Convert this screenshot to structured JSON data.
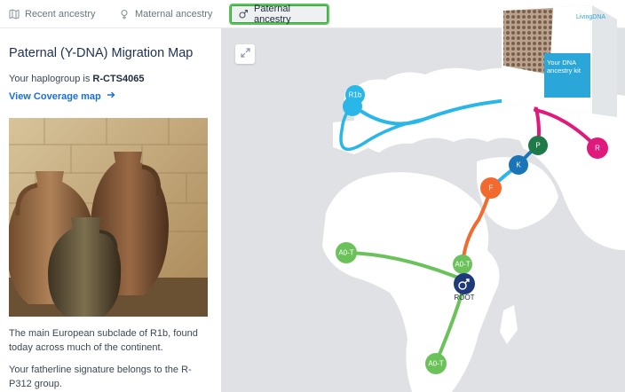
{
  "tabs": [
    {
      "label": "Recent ancestry",
      "icon": "map-icon"
    },
    {
      "label": "Maternal ancestry",
      "icon": "female-symbol-icon"
    },
    {
      "label": "Paternal ancestry",
      "icon": "male-symbol-icon",
      "active": true
    }
  ],
  "panel": {
    "title": "Paternal (Y-DNA) Migration Map",
    "haplogroup_prefix": "Your haplogroup is ",
    "haplogroup": "R-CTS4065",
    "coverage_link": "View Coverage map",
    "description_1": "The main European subclade of R1b, found today across much of the continent.",
    "description_2": "Your fatherline signature belongs to the R-P312 group."
  },
  "map": {
    "nodes": [
      {
        "label": "R1b",
        "color": "#29b6e8"
      },
      {
        "label": "R",
        "color": "#e0197c"
      },
      {
        "label": "P",
        "color": "#1f7a4a"
      },
      {
        "label": "K",
        "color": "#1a74b8"
      },
      {
        "label": "F",
        "color": "#f26a2e"
      },
      {
        "label": "A0-T",
        "color": "#6cc25a"
      },
      {
        "label": "ROOT",
        "color": "#1e3a78"
      }
    ],
    "kit": {
      "brand": "LivingDNA",
      "line1": "Your DNA",
      "line2": "ancestry kit"
    }
  },
  "colors": {
    "accent": "#1a6fd0",
    "active_tab_border": "#5cc45c"
  }
}
